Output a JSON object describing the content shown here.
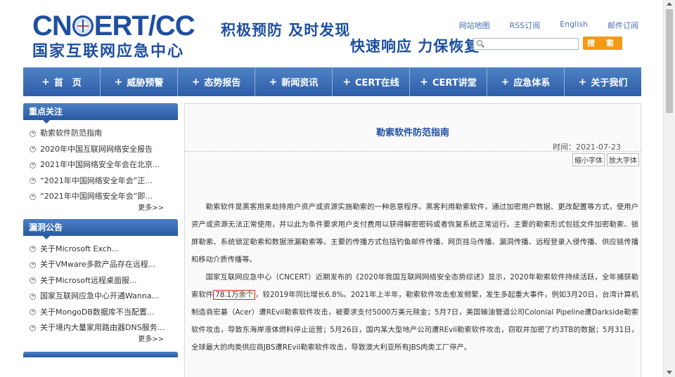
{
  "header": {
    "logo_en_left": "CN",
    "logo_en_right": "ERT/CC",
    "logo_cn": "国家互联网应急中心",
    "slogan1": "积极预防 及时发现",
    "slogan2": "快速响应 力保恢复",
    "links": [
      "网站地图",
      "RSS订阅",
      "English",
      "邮件订阅"
    ],
    "search_value": "",
    "search_button": "搜 索"
  },
  "nav": [
    "首　页",
    "威胁预警",
    "态势报告",
    "新闻资讯",
    "CERT在线",
    "CERT讲堂",
    "应急体系",
    "关于我们"
  ],
  "sidebar": {
    "focus_title": "重点关注",
    "focus_items": [
      "勒索软件防范指南",
      "2020年中国互联网网络安全报告",
      "2021年中国网络安全年会在北京...",
      "“2021年中国网络安全年会”正...",
      "“2021年中国网络安全年会”即..."
    ],
    "focus_more": "更多>>",
    "vuln_title": "漏洞公告",
    "vuln_items": [
      "关于Microsoft Exch...",
      "关于VMware多款产品存在远程...",
      "关于Microsoft远程桌面服...",
      "国家互联网应急中心开通Wanna...",
      "关于MongoDB数据库不当配置...",
      "关于境内大量家用路由器DNS服务..."
    ],
    "vuln_more": "更多>>"
  },
  "article": {
    "title": "勒索软件防范指南",
    "time": "时间：2021-07-23",
    "font_small": "缩小字体",
    "font_large": "放大字体",
    "p1": "勒索软件是黑客用来劫持用户资产或资源实施勒索的一种恶意程序。黑客利用勒索软件，通过加密用户数据、更改配置等方式，使用户资产或资源无法正常使用，并以此为条件要求用户支付费用以获得解密密码或者恢复系统正常运行。主要的勒索形式包括文件加密勒索、锁屏勒索、系统锁定勒索和数据泄漏勒索等。主要的传播方式包括钓鱼邮件传播、网页挂马传播、漏洞传播、远程登录入侵传播、供应链传播和移动介质传播等。",
    "p2_before": "国家互联网应急中心（CNCERT）近期发布的《2020年我国互联网网络安全态势综述》显示，2020年勒索软件持续活跃，全年捕获勒索软件",
    "p2_highlight": "78.1万余个",
    "p2_after": "，较2019年同比增长6.8%。2021年上半年，勒索软件攻击愈发频繁，发生多起重大事件，例如3月20日，台湾计算机制造商宏碁（Acer）遭REvil勒索软件攻击，被要求支付5000万美元赎金；5月7日，美国输油管道公司Colonial Pipeline遭Darkside勒索软件攻击，导致东海岸液体燃料停止运营；5月26日，国内某大型地产公司遭REvil勒索软件攻击，窃取并加密了约3TB的数据；5月31日，全球最大的肉类供应商JBS遭REvil勒索软件攻击，导致澳大利亚所有JBS肉类工厂停产。"
  }
}
